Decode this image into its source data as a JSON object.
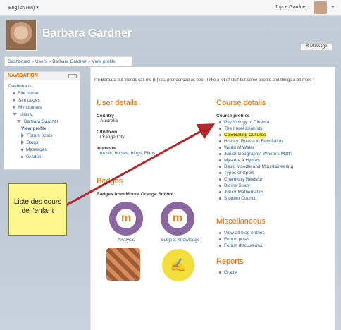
{
  "topbar": {
    "language": "English (en) ▾",
    "user_name": "Joyce Gardner"
  },
  "profile": {
    "name": "Barbara Gardner"
  },
  "breadcrumb": [
    "Dashboard",
    "Users",
    "Barbara Gardner",
    "View profile"
  ],
  "message_button": "Message",
  "navigation": {
    "title": "NAVIGATION",
    "items": [
      {
        "label": "Dashboard",
        "level": 1,
        "type": "plain"
      },
      {
        "label": "Site home",
        "level": 2,
        "type": "bullet"
      },
      {
        "label": "Site pages",
        "level": 2,
        "type": "tri"
      },
      {
        "label": "My courses",
        "level": 2,
        "type": "tri"
      },
      {
        "label": "Users",
        "level": 2,
        "type": "down"
      },
      {
        "label": "Barbara Gardner",
        "level": 3,
        "type": "down"
      },
      {
        "label": "View profile",
        "level": 4,
        "type": "bold"
      },
      {
        "label": "Forum posts",
        "level": 4,
        "type": "tri"
      },
      {
        "label": "Blogs",
        "level": 4,
        "type": "tri"
      },
      {
        "label": "Messages",
        "level": 4,
        "type": "bullet"
      },
      {
        "label": "Grades",
        "level": 4,
        "type": "bullet"
      }
    ]
  },
  "intro": "I'm Barbara but friends call me B (yes, pronounced as bee). I like a lot of stuff but some people and things a bit more !",
  "user_details": {
    "title": "User details",
    "country_label": "Country",
    "country": "Australia",
    "city_label": "City/town",
    "city": "Orange City",
    "interests_label": "Interests",
    "interests": "music, horses, blogs, Films"
  },
  "badges": {
    "title": "Badges",
    "subtitle": "Badges from Mount Orange School:",
    "items": [
      "Analysis",
      "Subject Knowledge"
    ]
  },
  "course_details": {
    "title": "Course details",
    "profiles_label": "Course profiles",
    "courses": [
      "Psychology in Cinema",
      "The Impressionists",
      "Celebrating Cultures",
      "History: Russia in Revolution",
      "World of Water",
      "Junior Geography: Where's Matt?",
      "Mystère à Hyères",
      "Basic Moodle and Mountaineering",
      "Types of Sport",
      "Chemistry Revision",
      "Biome Study",
      "Junior Mathematics",
      "Student Council"
    ],
    "highlighted": "Celebrating Cultures"
  },
  "misc": {
    "title": "Miscellaneous",
    "items": [
      "View all blog entries",
      "Forum posts",
      "Forum discussions"
    ]
  },
  "reports": {
    "title": "Reports",
    "items": [
      "Grade"
    ]
  },
  "annotation": {
    "text": "Liste des cours de l'enfant"
  }
}
